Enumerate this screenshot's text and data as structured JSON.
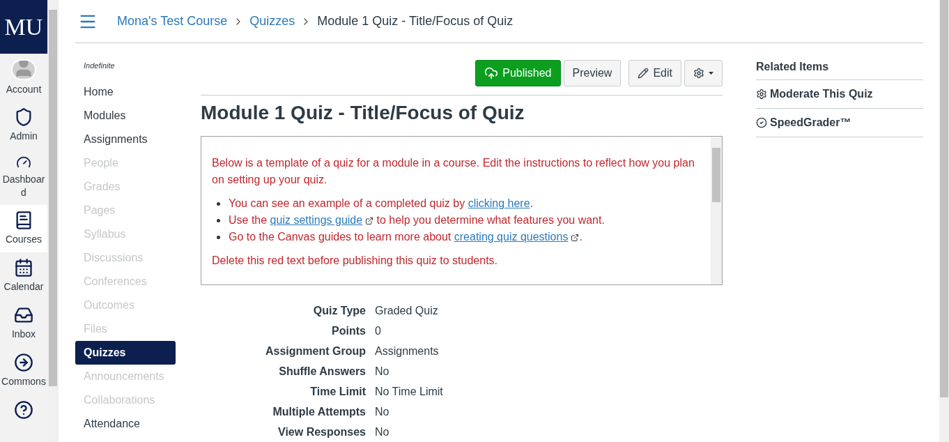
{
  "global_nav": {
    "logo": "MU",
    "items": [
      {
        "kind": "avatar",
        "label": "Account",
        "selected": false
      },
      {
        "kind": "admin",
        "label": "Admin",
        "selected": false
      },
      {
        "kind": "dashboard",
        "label": "Dashboard",
        "selected": false
      },
      {
        "kind": "courses",
        "label": "Courses",
        "selected": true
      },
      {
        "kind": "calendar",
        "label": "Calendar",
        "selected": false
      },
      {
        "kind": "inbox",
        "label": "Inbox",
        "selected": false
      },
      {
        "kind": "commons",
        "label": "Commons",
        "selected": false
      },
      {
        "kind": "help",
        "selected": false
      }
    ]
  },
  "breadcrumbs": [
    {
      "label": "Mona's Test Course",
      "link": true
    },
    {
      "label": "Quizzes",
      "link": true
    },
    {
      "label": "Module 1 Quiz - Title/Focus of Quiz",
      "link": false
    }
  ],
  "course_nav": {
    "term": "Indefinite",
    "items": [
      {
        "label": "Home",
        "disabled": false,
        "selected": false
      },
      {
        "label": "Modules",
        "disabled": false,
        "selected": false
      },
      {
        "label": "Assignments",
        "disabled": false,
        "selected": false
      },
      {
        "label": "People",
        "disabled": true,
        "selected": false
      },
      {
        "label": "Grades",
        "disabled": true,
        "selected": false
      },
      {
        "label": "Pages",
        "disabled": true,
        "selected": false
      },
      {
        "label": "Syllabus",
        "disabled": true,
        "selected": false
      },
      {
        "label": "Discussions",
        "disabled": true,
        "selected": false
      },
      {
        "label": "Conferences",
        "disabled": true,
        "selected": false
      },
      {
        "label": "Outcomes",
        "disabled": true,
        "selected": false
      },
      {
        "label": "Files",
        "disabled": true,
        "selected": false
      },
      {
        "label": "Quizzes",
        "disabled": false,
        "selected": true
      },
      {
        "label": "Announcements",
        "disabled": true,
        "selected": false
      },
      {
        "label": "Collaborations",
        "disabled": true,
        "selected": false
      },
      {
        "label": "Attendance",
        "disabled": false,
        "selected": false
      }
    ]
  },
  "toolbar": {
    "buttons": [
      {
        "kind": "published",
        "label": "Published"
      },
      {
        "kind": "preview",
        "label": "Preview"
      },
      {
        "kind": "edit",
        "label": "Edit"
      },
      {
        "kind": "settings"
      }
    ]
  },
  "quiz": {
    "title": "Module 1 Quiz - Title/Focus of Quiz",
    "description": {
      "intro": "Below is a template of a quiz for a module in a course.  Edit the instructions to reflect how you plan on setting up your quiz.",
      "bullets": [
        [
          {
            "kind": "text",
            "text": "You can see an example of a completed quiz by "
          },
          {
            "kind": "link",
            "text": "clicking here"
          },
          {
            "kind": "text",
            "text": "."
          }
        ],
        [
          {
            "kind": "text",
            "text": "Use the "
          },
          {
            "kind": "external_link",
            "text": "quiz settings guide"
          },
          {
            "kind": "text",
            "text": " to help you determine what features you want."
          }
        ],
        [
          {
            "kind": "text",
            "text": "Go to the Canvas guides to learn more about "
          },
          {
            "kind": "external_link",
            "text": "creating quiz questions"
          },
          {
            "kind": "text",
            "text": "."
          }
        ]
      ],
      "footer": "Delete this red text before publishing this quiz to students."
    },
    "details": [
      {
        "label": "Quiz Type",
        "value": "Graded Quiz"
      },
      {
        "label": "Points",
        "value": "0"
      },
      {
        "label": "Assignment Group",
        "value": "Assignments"
      },
      {
        "label": "Shuffle Answers",
        "value": "No"
      },
      {
        "label": "Time Limit",
        "value": "No Time Limit"
      },
      {
        "label": "Multiple Attempts",
        "value": "No"
      },
      {
        "label": "View Responses",
        "value": "No"
      }
    ]
  },
  "related": {
    "title": "Related Items",
    "items": [
      {
        "kind": "moderate",
        "label": "Moderate This Quiz"
      },
      {
        "kind": "speedgrader",
        "label": "SpeedGrader™"
      }
    ]
  }
}
